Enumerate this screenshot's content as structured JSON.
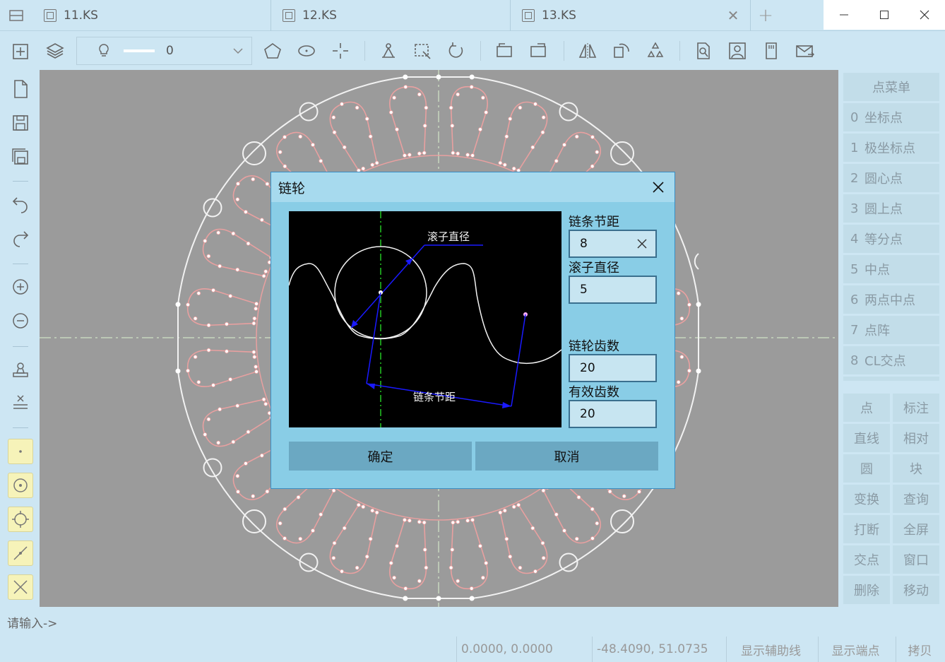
{
  "tabs": [
    {
      "label": "11.KS"
    },
    {
      "label": "12.KS"
    },
    {
      "label": "13.KS"
    }
  ],
  "toolbar": {
    "line_width_value": "0"
  },
  "dialog": {
    "title": "链轮",
    "preview_labels": {
      "roller_diameter": "滚子直径",
      "chain_pitch": "链条节距"
    },
    "fields": {
      "chain_pitch_label": "链条节距",
      "chain_pitch_value": "8",
      "roller_diameter_label": "滚子直径",
      "roller_diameter_value": "5",
      "sprocket_teeth_label": "链轮齿数",
      "sprocket_teeth_value": "20",
      "effective_teeth_label": "有效齿数",
      "effective_teeth_value": "20"
    },
    "ok_label": "确定",
    "cancel_label": "取消"
  },
  "point_menu": {
    "title": "点菜单",
    "items": [
      {
        "num": "0",
        "label": "坐标点"
      },
      {
        "num": "1",
        "label": "极坐标点"
      },
      {
        "num": "2",
        "label": "圆心点"
      },
      {
        "num": "3",
        "label": "圆上点"
      },
      {
        "num": "4",
        "label": "等分点"
      },
      {
        "num": "5",
        "label": "中点"
      },
      {
        "num": "6",
        "label": "两点中点"
      },
      {
        "num": "7",
        "label": "点阵"
      },
      {
        "num": "8",
        "label": "CL交点"
      }
    ]
  },
  "command_grid": [
    [
      "点",
      "标注"
    ],
    [
      "直线",
      "相对"
    ],
    [
      "圆",
      "块"
    ],
    [
      "变换",
      "查询"
    ],
    [
      "打断",
      "全屏"
    ],
    [
      "交点",
      "窗口"
    ],
    [
      "删除",
      "移动"
    ]
  ],
  "command_prompt": "请输入->",
  "status": {
    "coord1": "0.0000, 0.0000",
    "coord2": "-48.4090, 51.0735",
    "show_aux_lines": "显示辅助线",
    "show_endpoints": "显示端点",
    "copy": "拷贝"
  },
  "colors": {
    "canvas_bg": "#9b9b9b",
    "geometry_white": "#f2f2f2",
    "geometry_pink": "#e8a0a0",
    "dialog_bg": "#89cde6",
    "button_bg": "#6ba8c2"
  }
}
